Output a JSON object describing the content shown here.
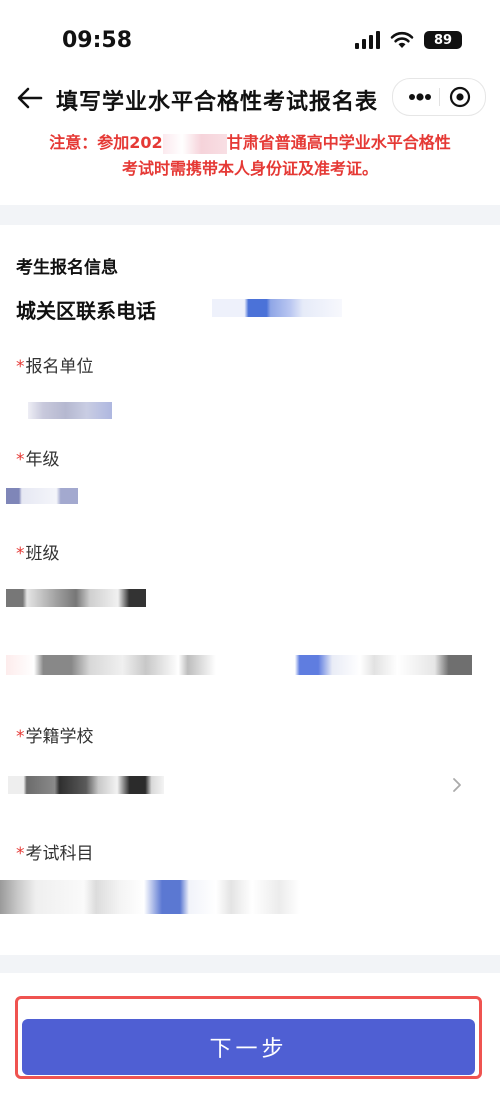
{
  "status_bar": {
    "time": "09:58",
    "battery": "89"
  },
  "nav": {
    "title": "填写学业水平合格性考试报名表"
  },
  "notice": {
    "line1_prefix": "注意：参加202",
    "line1_suffix": "甘肃省普通高中学业水平合格性",
    "line2": "考试时需携带本人身份证及准考证。"
  },
  "form": {
    "section_title": "考生报名信息",
    "phone_label": "城关区联系电话",
    "required_mark": "*",
    "fields": [
      {
        "label": "报名单位"
      },
      {
        "label": "年级"
      },
      {
        "label": "班级"
      },
      {
        "label": "学籍学校"
      },
      {
        "label": "考试科目"
      }
    ]
  },
  "footer": {
    "next_label": "下一步"
  },
  "colors": {
    "accent": "#4f5fd3",
    "warning": "#e53935",
    "highlight_border": "#ef5350"
  }
}
